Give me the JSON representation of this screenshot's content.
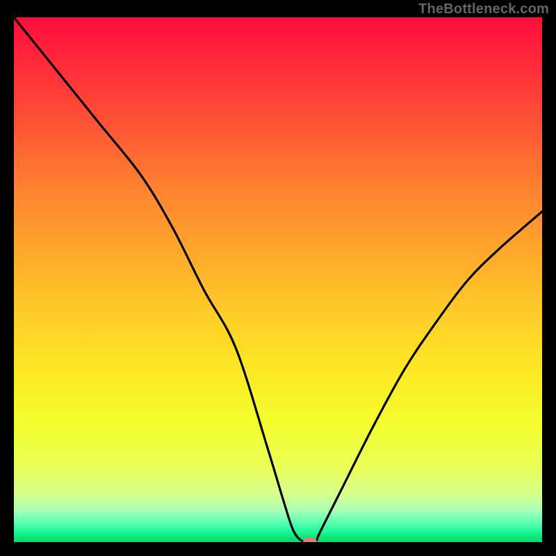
{
  "attribution": "TheBottleneck.com",
  "accent_marker_color": "#e67a7a",
  "chart_data": {
    "type": "line",
    "title": "",
    "xlabel": "",
    "ylabel": "",
    "xlim": [
      0,
      100
    ],
    "ylim": [
      0,
      100
    ],
    "grid": false,
    "legend": false,
    "series": [
      {
        "name": "bottleneck-curve",
        "x": [
          0,
          8,
          16,
          24,
          30,
          36,
          42,
          48,
          51,
          53,
          55,
          57,
          58,
          62,
          68,
          74,
          80,
          86,
          92,
          100
        ],
        "y": [
          100,
          90,
          80,
          70,
          60,
          48,
          37,
          18,
          8,
          2,
          0,
          0,
          2,
          10,
          22,
          33,
          42,
          50,
          56,
          63
        ]
      }
    ],
    "marker": {
      "x": 56,
      "y": 0
    },
    "background_gradient_stops": [
      {
        "pos": 0.0,
        "color": "#ff0d3c"
      },
      {
        "pos": 0.45,
        "color": "#ffa92c"
      },
      {
        "pos": 0.78,
        "color": "#f3ff30"
      },
      {
        "pos": 0.98,
        "color": "#1ef796"
      },
      {
        "pos": 1.0,
        "color": "#09d46e"
      }
    ]
  }
}
